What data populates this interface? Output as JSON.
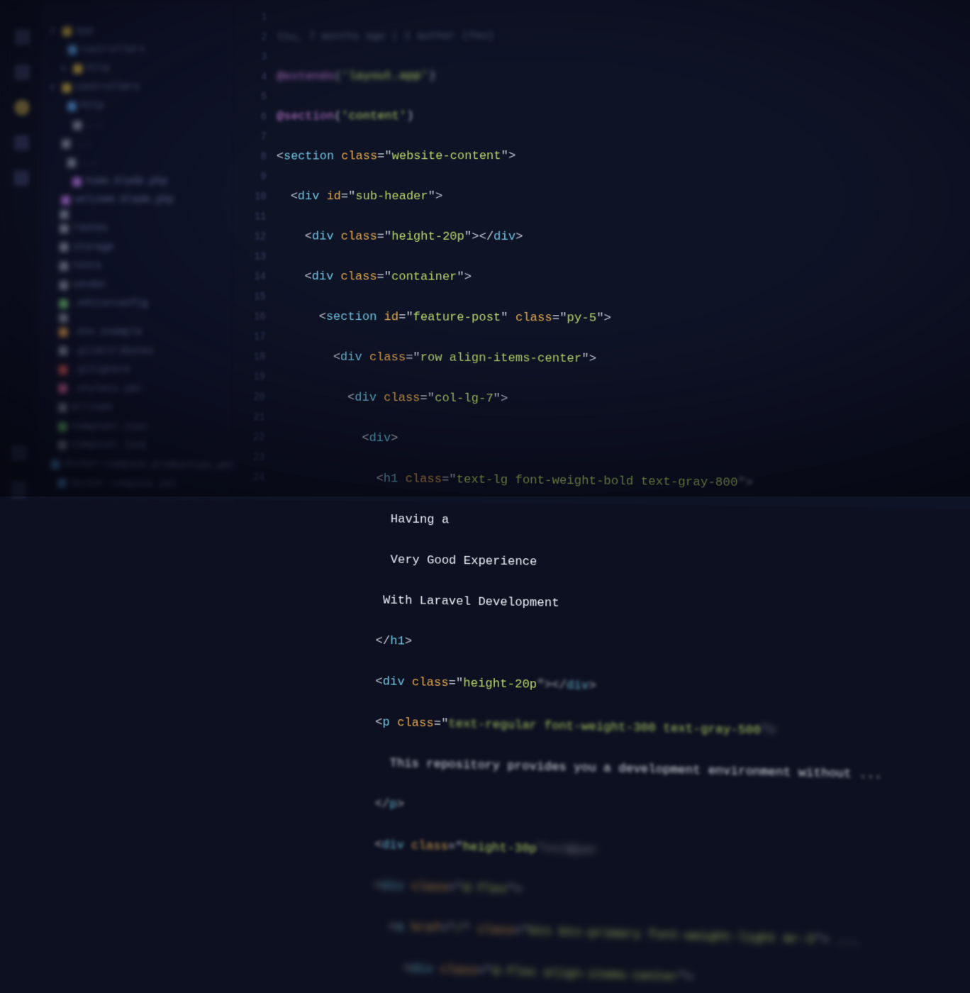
{
  "blame": "You, 7 months ago | 1 author (You)",
  "sidebar": {
    "items": [
      {
        "icon": "folder",
        "label": "app"
      },
      {
        "icon": "blue",
        "label": "controllers"
      },
      {
        "icon": "folder",
        "label": "http"
      },
      {
        "icon": "folder",
        "label": "controllers"
      },
      {
        "icon": "blue",
        "label": "http"
      },
      {
        "icon": "grey",
        "label": "..."
      },
      {
        "icon": "grey",
        "label": "..."
      },
      {
        "icon": "grey",
        "label": "..."
      },
      {
        "icon": "purple",
        "label": "home.blade.php"
      },
      {
        "icon": "purple",
        "label": "welcome.blade.php"
      },
      {
        "icon": "grey",
        "label": ""
      },
      {
        "icon": "grey",
        "label": "routes"
      },
      {
        "icon": "grey",
        "label": "storage"
      },
      {
        "icon": "grey",
        "label": "tests"
      },
      {
        "icon": "grey",
        "label": "vendor"
      },
      {
        "icon": "green",
        "label": ".editorconfig"
      },
      {
        "icon": "grey",
        "label": ""
      },
      {
        "icon": "orange",
        "label": ".env.example"
      },
      {
        "icon": "grey",
        "label": ".gitattributes"
      },
      {
        "icon": "red",
        "label": ".gitignore"
      },
      {
        "icon": "pink",
        "label": ".styleci.yml"
      },
      {
        "icon": "grey",
        "label": "artisan"
      },
      {
        "icon": "green",
        "label": "composer.json"
      },
      {
        "icon": "grey",
        "label": "composer.lock"
      },
      {
        "icon": "blue",
        "label": "docker-compose.production.yml"
      },
      {
        "icon": "blue",
        "label": "docker-compose.yml"
      }
    ]
  },
  "code": {
    "line1_extends": "@extends",
    "line1_arg": "'layout.app'",
    "line2_section": "@section",
    "line2_arg": "'content'",
    "l3": {
      "tag": "section",
      "attr": "class",
      "val": "website-content"
    },
    "l4": {
      "tag": "div",
      "attr": "id",
      "val": "sub-header"
    },
    "l5": {
      "tag": "div",
      "attr": "class",
      "val": "height-20p"
    },
    "l6": {
      "tag": "div",
      "attr": "class",
      "val": "container"
    },
    "l7": {
      "tag": "section",
      "a1": "id",
      "v1": "feature-post",
      "a2": "class",
      "v2": "py-5"
    },
    "l8": {
      "tag": "div",
      "attr": "class",
      "val": "row align-items-center"
    },
    "l9": {
      "tag": "div",
      "attr": "class",
      "val": "col-lg-7"
    },
    "l10": {
      "tag": "div"
    },
    "l11": {
      "tag": "h1",
      "attr": "class",
      "val": "text-lg font-weight-bold text-gray-800"
    },
    "t12": "Having a",
    "t13": "Very Good Experience",
    "t14": "With Laravel Development",
    "c15": "h1",
    "l16": {
      "tag": "div",
      "attr": "class",
      "val": "height-20p"
    },
    "l17": {
      "tag": "p",
      "attr": "class",
      "val": "text-regular font-weight-300 text-gray-500"
    },
    "t18": "This repository provides you a development environment without ...",
    "c19": "p",
    "l20": {
      "tag": "div",
      "attr": "class",
      "val": "height-30p"
    },
    "l21": {
      "tag": "div",
      "attr": "class",
      "val": "d-flex"
    },
    "l22": {
      "tag": "a",
      "a1": "href",
      "v1": "/",
      "a2": "class",
      "v2": "btn btn-primary font-weight-light mr-3"
    },
    "l23": {
      "tag": "div",
      "attr": "class",
      "val": "d-flex align-items-center"
    }
  },
  "line_numbers": [
    "",
    "1",
    "2",
    "3",
    "4",
    "5",
    "6",
    "7",
    "8",
    "9",
    "10",
    "11",
    "12",
    "13",
    "14",
    "15",
    "16",
    "17",
    "18",
    "19",
    "20",
    "21",
    "22",
    "23",
    "24"
  ]
}
